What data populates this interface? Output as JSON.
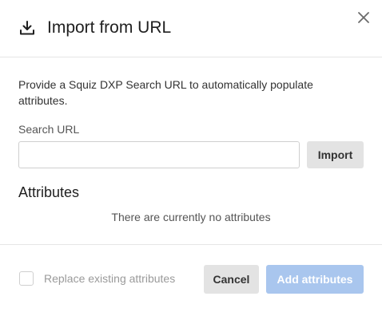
{
  "dialog": {
    "title": "Import from URL",
    "title_icon": "download-icon",
    "close_icon": "close-icon"
  },
  "body": {
    "description": "Provide a Squiz DXP Search URL to automatically populate attributes.",
    "search_url_label": "Search URL",
    "search_url_value": "",
    "search_url_placeholder": "",
    "import_button": "Import",
    "attributes_heading": "Attributes",
    "empty_message": "There are currently no attributes"
  },
  "footer": {
    "replace_label": "Replace existing attributes",
    "replace_checked": false,
    "cancel_button": "Cancel",
    "add_button": "Add attributes"
  },
  "colors": {
    "primary_disabled": "#a9c6ee",
    "secondary_button": "#e3e3e3",
    "divider": "#e6e6e6"
  }
}
